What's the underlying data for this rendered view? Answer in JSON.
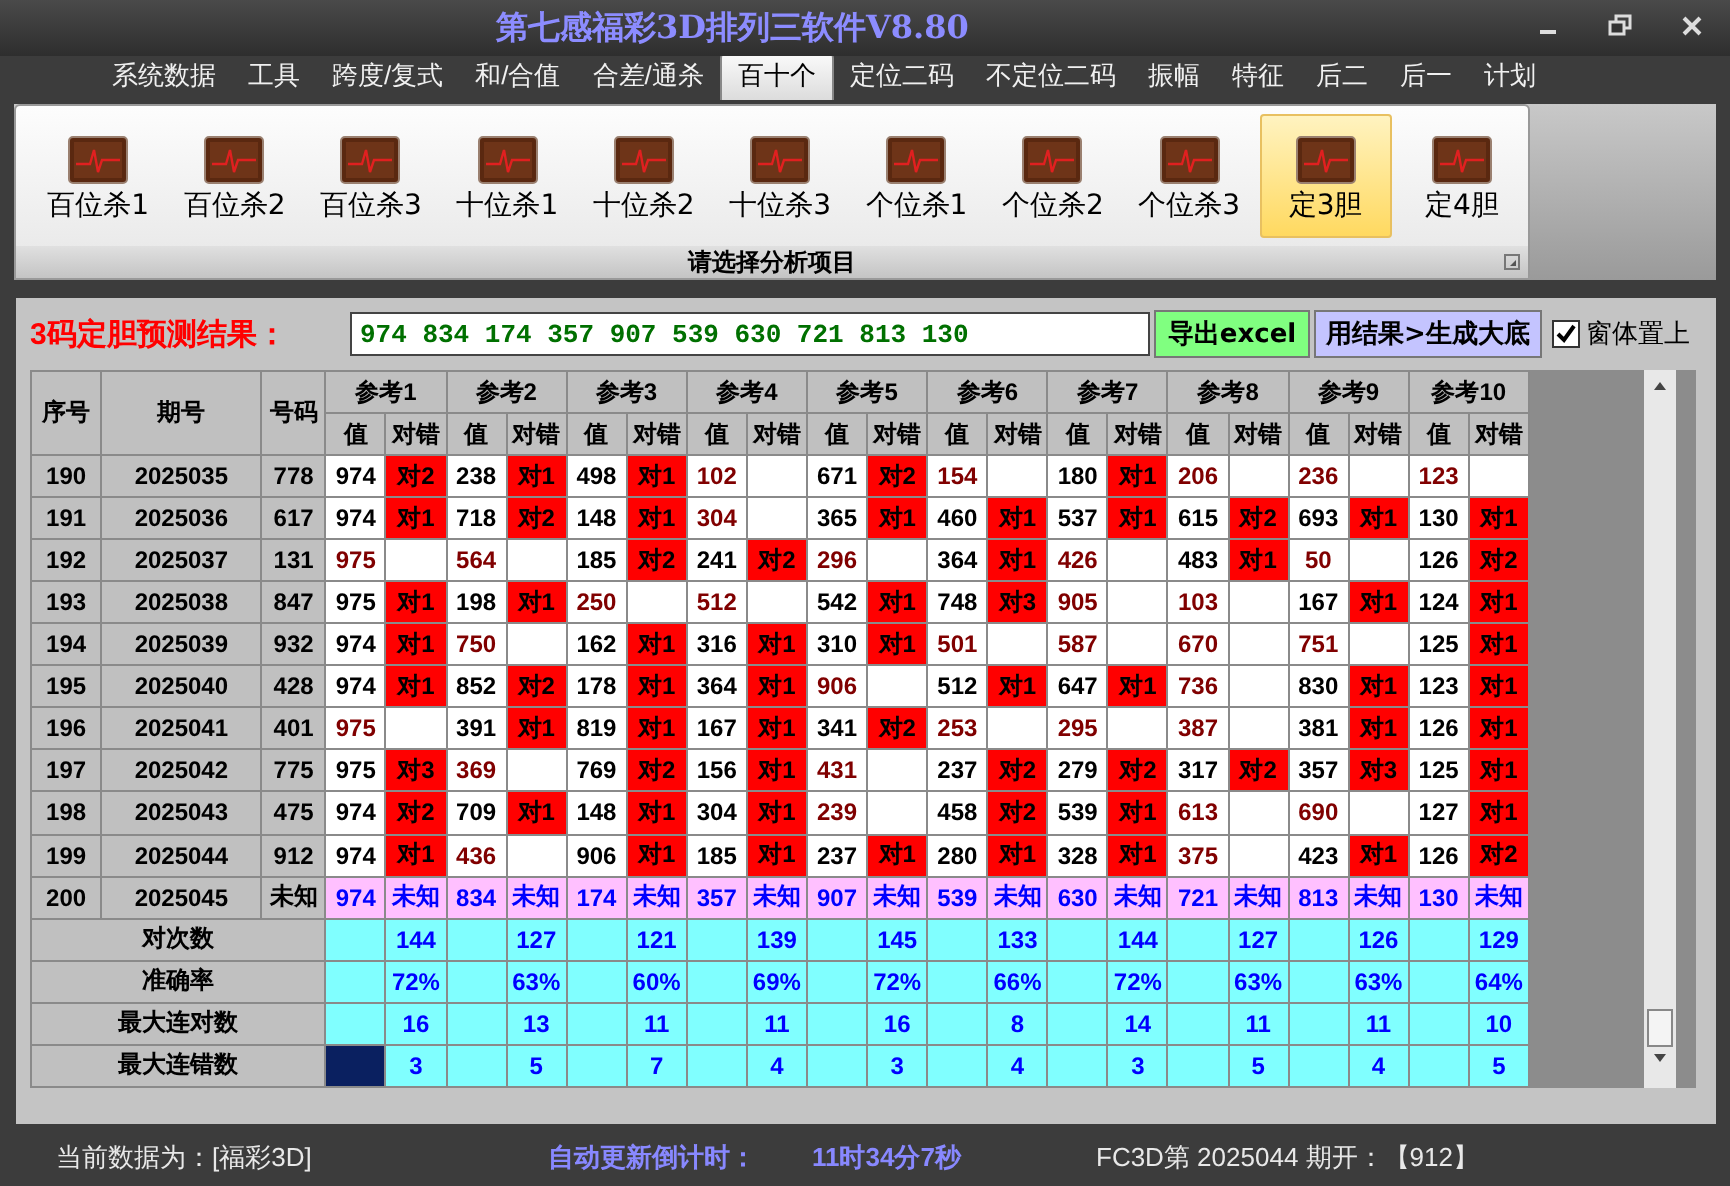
{
  "window": {
    "title": "第七感福彩3D排列三软件V8.80"
  },
  "menu": {
    "tabs": [
      {
        "label": "系统数据",
        "selected": false
      },
      {
        "label": "工具",
        "selected": false
      },
      {
        "label": "跨度/复式",
        "selected": false
      },
      {
        "label": "和/合值",
        "selected": false
      },
      {
        "label": "合差/通杀",
        "selected": false
      },
      {
        "label": "百十个",
        "selected": true
      },
      {
        "label": "定位二码",
        "selected": false
      },
      {
        "label": "不定位二码",
        "selected": false
      },
      {
        "label": "振幅",
        "selected": false
      },
      {
        "label": "特征",
        "selected": false
      },
      {
        "label": "后二",
        "selected": false
      },
      {
        "label": "后一",
        "selected": false
      },
      {
        "label": "计划",
        "selected": false
      }
    ]
  },
  "ribbon": {
    "items": [
      {
        "label": "百位杀1",
        "selected": false
      },
      {
        "label": "百位杀2",
        "selected": false
      },
      {
        "label": "百位杀3",
        "selected": false
      },
      {
        "label": "十位杀1",
        "selected": false
      },
      {
        "label": "十位杀2",
        "selected": false
      },
      {
        "label": "十位杀3",
        "selected": false
      },
      {
        "label": "个位杀1",
        "selected": false
      },
      {
        "label": "个位杀2",
        "selected": false
      },
      {
        "label": "个位杀3",
        "selected": false
      },
      {
        "label": "定3胆",
        "selected": true
      },
      {
        "label": "定4胆",
        "selected": false
      }
    ],
    "caption": "请选择分析项目"
  },
  "result_bar": {
    "label": "3码定胆预测结果：",
    "value": "974 834 174 357 907 539 630 721 813 130",
    "export_button": "导出excel",
    "generate_button": "用结果>生成大底",
    "checkbox": {
      "label": "窗体置上",
      "checked": true
    }
  },
  "table": {
    "columns": [
      "序号",
      "期号",
      "号码"
    ],
    "groups": [
      {
        "label": "参考1",
        "subcolumns": [
          "值",
          "对错"
        ]
      },
      {
        "label": "参考2",
        "subcolumns": [
          "值",
          "对错"
        ]
      },
      {
        "label": "参考3",
        "subcolumns": [
          "值",
          "对错"
        ]
      },
      {
        "label": "参考4",
        "subcolumns": [
          "值",
          "对错"
        ]
      },
      {
        "label": "参考5",
        "subcolumns": [
          "值",
          "对错"
        ]
      },
      {
        "label": "参考6",
        "subcolumns": [
          "值",
          "对错"
        ]
      },
      {
        "label": "参考7",
        "subcolumns": [
          "值",
          "对错"
        ]
      },
      {
        "label": "参考8",
        "subcolumns": [
          "值",
          "对错"
        ]
      },
      {
        "label": "参考9",
        "subcolumns": [
          "值",
          "对错"
        ]
      },
      {
        "label": "参考10",
        "subcolumns": [
          "值",
          "对错"
        ]
      }
    ],
    "rows": [
      {
        "seq": "190",
        "period": "2025035",
        "number": "778",
        "refs": [
          {
            "value": "974",
            "hit": true,
            "result": "对2"
          },
          {
            "value": "238",
            "hit": true,
            "result": "对1"
          },
          {
            "value": "498",
            "hit": true,
            "result": "对1"
          },
          {
            "value": "102",
            "hit": false
          },
          {
            "value": "671",
            "hit": true,
            "result": "对2"
          },
          {
            "value": "154",
            "hit": false
          },
          {
            "value": "180",
            "hit": true,
            "result": "对1"
          },
          {
            "value": "206",
            "hit": false
          },
          {
            "value": "236",
            "hit": false
          },
          {
            "value": "123",
            "hit": false
          }
        ]
      },
      {
        "seq": "191",
        "period": "2025036",
        "number": "617",
        "refs": [
          {
            "value": "974",
            "hit": true,
            "result": "对1"
          },
          {
            "value": "718",
            "hit": true,
            "result": "对2"
          },
          {
            "value": "148",
            "hit": true,
            "result": "对1"
          },
          {
            "value": "304",
            "hit": false
          },
          {
            "value": "365",
            "hit": true,
            "result": "对1"
          },
          {
            "value": "460",
            "hit": true,
            "result": "对1"
          },
          {
            "value": "537",
            "hit": true,
            "result": "对1"
          },
          {
            "value": "615",
            "hit": true,
            "result": "对2"
          },
          {
            "value": "693",
            "hit": true,
            "result": "对1"
          },
          {
            "value": "130",
            "hit": true,
            "result": "对1"
          }
        ]
      },
      {
        "seq": "192",
        "period": "2025037",
        "number": "131",
        "refs": [
          {
            "value": "975",
            "hit": false
          },
          {
            "value": "564",
            "hit": false
          },
          {
            "value": "185",
            "hit": true,
            "result": "对2"
          },
          {
            "value": "241",
            "hit": true,
            "result": "对2"
          },
          {
            "value": "296",
            "hit": false
          },
          {
            "value": "364",
            "hit": true,
            "result": "对1"
          },
          {
            "value": "426",
            "hit": false
          },
          {
            "value": "483",
            "hit": true,
            "result": "对1"
          },
          {
            "value": "50",
            "hit": false
          },
          {
            "value": "126",
            "hit": true,
            "result": "对2"
          }
        ]
      },
      {
        "seq": "193",
        "period": "2025038",
        "number": "847",
        "refs": [
          {
            "value": "975",
            "hit": true,
            "result": "对1"
          },
          {
            "value": "198",
            "hit": true,
            "result": "对1"
          },
          {
            "value": "250",
            "hit": false
          },
          {
            "value": "512",
            "hit": false
          },
          {
            "value": "542",
            "hit": true,
            "result": "对1"
          },
          {
            "value": "748",
            "hit": true,
            "result": "对3"
          },
          {
            "value": "905",
            "hit": false
          },
          {
            "value": "103",
            "hit": false
          },
          {
            "value": "167",
            "hit": true,
            "result": "对1"
          },
          {
            "value": "124",
            "hit": true,
            "result": "对1"
          }
        ]
      },
      {
        "seq": "194",
        "period": "2025039",
        "number": "932",
        "refs": [
          {
            "value": "974",
            "hit": true,
            "result": "对1"
          },
          {
            "value": "750",
            "hit": false
          },
          {
            "value": "162",
            "hit": true,
            "result": "对1"
          },
          {
            "value": "316",
            "hit": true,
            "result": "对1"
          },
          {
            "value": "310",
            "hit": true,
            "result": "对1"
          },
          {
            "value": "501",
            "hit": false
          },
          {
            "value": "587",
            "hit": false
          },
          {
            "value": "670",
            "hit": false
          },
          {
            "value": "751",
            "hit": false
          },
          {
            "value": "125",
            "hit": true,
            "result": "对1"
          }
        ]
      },
      {
        "seq": "195",
        "period": "2025040",
        "number": "428",
        "refs": [
          {
            "value": "974",
            "hit": true,
            "result": "对1"
          },
          {
            "value": "852",
            "hit": true,
            "result": "对2"
          },
          {
            "value": "178",
            "hit": true,
            "result": "对1"
          },
          {
            "value": "364",
            "hit": true,
            "result": "对1"
          },
          {
            "value": "906",
            "hit": false
          },
          {
            "value": "512",
            "hit": true,
            "result": "对1"
          },
          {
            "value": "647",
            "hit": true,
            "result": "对1"
          },
          {
            "value": "736",
            "hit": false
          },
          {
            "value": "830",
            "hit": true,
            "result": "对1"
          },
          {
            "value": "123",
            "hit": true,
            "result": "对1"
          }
        ]
      },
      {
        "seq": "196",
        "period": "2025041",
        "number": "401",
        "refs": [
          {
            "value": "975",
            "hit": false
          },
          {
            "value": "391",
            "hit": true,
            "result": "对1"
          },
          {
            "value": "819",
            "hit": true,
            "result": "对1"
          },
          {
            "value": "167",
            "hit": true,
            "result": "对1"
          },
          {
            "value": "341",
            "hit": true,
            "result": "对2"
          },
          {
            "value": "253",
            "hit": false
          },
          {
            "value": "295",
            "hit": false
          },
          {
            "value": "387",
            "hit": false
          },
          {
            "value": "381",
            "hit": true,
            "result": "对1"
          },
          {
            "value": "126",
            "hit": true,
            "result": "对1"
          }
        ]
      },
      {
        "seq": "197",
        "period": "2025042",
        "number": "775",
        "refs": [
          {
            "value": "975",
            "hit": true,
            "result": "对3"
          },
          {
            "value": "369",
            "hit": false
          },
          {
            "value": "769",
            "hit": true,
            "result": "对2"
          },
          {
            "value": "156",
            "hit": true,
            "result": "对1"
          },
          {
            "value": "431",
            "hit": false
          },
          {
            "value": "237",
            "hit": true,
            "result": "对2"
          },
          {
            "value": "279",
            "hit": true,
            "result": "对2"
          },
          {
            "value": "317",
            "hit": true,
            "result": "对2"
          },
          {
            "value": "357",
            "hit": true,
            "result": "对3"
          },
          {
            "value": "125",
            "hit": true,
            "result": "对1"
          }
        ]
      },
      {
        "seq": "198",
        "period": "2025043",
        "number": "475",
        "refs": [
          {
            "value": "974",
            "hit": true,
            "result": "对2"
          },
          {
            "value": "709",
            "hit": true,
            "result": "对1"
          },
          {
            "value": "148",
            "hit": true,
            "result": "对1"
          },
          {
            "value": "304",
            "hit": true,
            "result": "对1"
          },
          {
            "value": "239",
            "hit": false
          },
          {
            "value": "458",
            "hit": true,
            "result": "对2"
          },
          {
            "value": "539",
            "hit": true,
            "result": "对1"
          },
          {
            "value": "613",
            "hit": false
          },
          {
            "value": "690",
            "hit": false
          },
          {
            "value": "127",
            "hit": true,
            "result": "对1"
          }
        ]
      },
      {
        "seq": "199",
        "period": "2025044",
        "number": "912",
        "refs": [
          {
            "value": "974",
            "hit": true,
            "result": "对1"
          },
          {
            "value": "436",
            "hit": false
          },
          {
            "value": "906",
            "hit": true,
            "result": "对1"
          },
          {
            "value": "185",
            "hit": true,
            "result": "对1"
          },
          {
            "value": "237",
            "hit": true,
            "result": "对1"
          },
          {
            "value": "280",
            "hit": true,
            "result": "对1"
          },
          {
            "value": "328",
            "hit": true,
            "result": "对1"
          },
          {
            "value": "375",
            "hit": false
          },
          {
            "value": "423",
            "hit": true,
            "result": "对1"
          },
          {
            "value": "126",
            "hit": true,
            "result": "对2"
          }
        ]
      }
    ],
    "prediction_row": {
      "seq": "200",
      "period": "2025045",
      "number": "未知",
      "refs": [
        {
          "value": "974",
          "result": "未知"
        },
        {
          "value": "834",
          "result": "未知"
        },
        {
          "value": "174",
          "result": "未知"
        },
        {
          "value": "357",
          "result": "未知"
        },
        {
          "value": "907",
          "result": "未知"
        },
        {
          "value": "539",
          "result": "未知"
        },
        {
          "value": "630",
          "result": "未知"
        },
        {
          "value": "721",
          "result": "未知"
        },
        {
          "value": "813",
          "result": "未知"
        },
        {
          "value": "130",
          "result": "未知"
        }
      ]
    },
    "stats": [
      {
        "label": "对次数",
        "cursor": false,
        "values": [
          "144",
          "127",
          "121",
          "139",
          "145",
          "133",
          "144",
          "127",
          "126",
          "129"
        ]
      },
      {
        "label": "准确率",
        "cursor": false,
        "values": [
          "72%",
          "63%",
          "60%",
          "69%",
          "72%",
          "66%",
          "72%",
          "63%",
          "63%",
          "64%"
        ]
      },
      {
        "label": "最大连对数",
        "cursor": false,
        "values": [
          "16",
          "13",
          "11",
          "11",
          "16",
          "8",
          "14",
          "11",
          "11",
          "10"
        ]
      },
      {
        "label": "最大连错数",
        "cursor": true,
        "values": [
          "3",
          "5",
          "7",
          "4",
          "3",
          "4",
          "3",
          "5",
          "4",
          "5"
        ]
      }
    ]
  },
  "status_bar": {
    "data_source": "当前数据为：[福彩3D]",
    "countdown_label": "自动更新倒计时：",
    "countdown": "11时34分7秒",
    "draw_info": "FC3D第 2025044 期开：【912】"
  }
}
